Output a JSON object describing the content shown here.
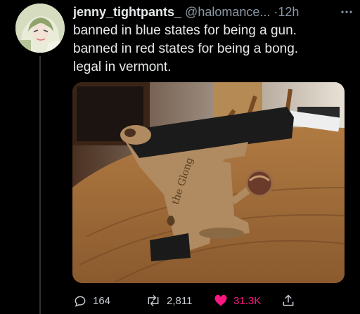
{
  "tweet": {
    "display_name": "jenny_tightpants_",
    "handle": "@halomance...",
    "separator": "·",
    "time": "12h",
    "more_icon": "more-dots-icon",
    "text_lines": [
      "banned in blue states for being a gun.",
      "banned in red states for being a bong.",
      "legal in vermont."
    ],
    "image_text": "the Glong",
    "metrics": {
      "replies": "164",
      "retweets": "2,811",
      "likes": "31.3K"
    },
    "colors": {
      "like": "#f91880",
      "muted": "#8b98a5",
      "text": "#e7e9ea"
    }
  }
}
